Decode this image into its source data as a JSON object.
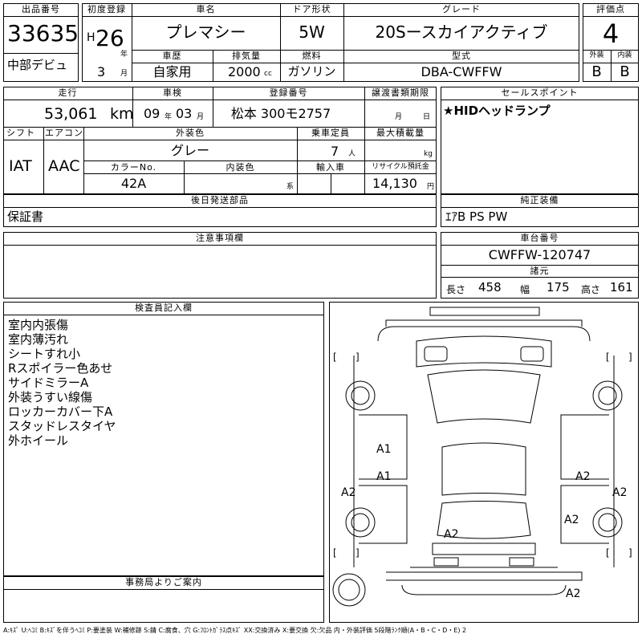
{
  "header": {
    "lot_number_label": "出品番号",
    "lot_number": "33635",
    "venue": "中部デビュ",
    "first_reg_label": "初度登録",
    "era": "H",
    "reg_year": "26",
    "year_unit": "年",
    "reg_month": "3",
    "month_unit": "月",
    "car_name_label": "車名",
    "car_name": "プレマシー",
    "door_label": "ドア形状",
    "doors": "5W",
    "grade_label": "グレード",
    "grade": "20Sースカイアクティブ",
    "score_label": "評価点",
    "score": "4",
    "history_label": "車歴",
    "history": "自家用",
    "displacement_label": "排気量",
    "displacement": "2000",
    "displacement_unit": "cc",
    "fuel_label": "燃料",
    "fuel": "ガソリン",
    "model_label": "型式",
    "model": "DBA-CWFFW",
    "exterior_label": "外装",
    "exterior_grade": "B",
    "interior_label": "内装",
    "interior_grade": "B"
  },
  "row2": {
    "mileage_label": "走行",
    "mileage": "53,061",
    "mileage_unit": "km",
    "inspection_label": "車検",
    "insp_year": "09",
    "insp_year_unit": "年",
    "insp_month": "03",
    "insp_month_unit": "月",
    "plate_label": "登録番号",
    "plate": "松本 300モ2757",
    "transfer_label": "譲渡書類期限",
    "transfer_month": "月",
    "transfer_day": "日",
    "sales_label": "セールスポイント",
    "sales_point": "★HIDヘッドランプ"
  },
  "row3": {
    "shift_label": "シフト",
    "shift": "IAT",
    "ac_label": "エアコン",
    "ac": "AAC",
    "ext_color_label": "外装色",
    "ext_color": "グレー",
    "capacity_label": "乗車定員",
    "capacity": "7",
    "capacity_unit": "人",
    "max_load_label": "最大積載量",
    "max_load_unit": "kg",
    "color_no_label": "カラーNo.",
    "color_no": "42A",
    "int_color_label": "内装色",
    "int_color_unit": "系",
    "import_label": "輸入車",
    "recycle_label": "リサイクル預託金",
    "recycle": "14,130",
    "recycle_unit": "円"
  },
  "parts": {
    "label": "後日発送部品",
    "value": "保証書"
  },
  "equipment": {
    "label": "純正装備",
    "value": "ｴｱB PS PW"
  },
  "caution": {
    "label": "注意事項欄"
  },
  "chassis": {
    "label": "車台番号",
    "number": "CWFFW-120747",
    "specs_label": "諸元",
    "length_label": "長さ",
    "length": "458",
    "width_label": "幅",
    "width": "175",
    "height_label": "高さ",
    "height": "161"
  },
  "inspector": {
    "label": "検査員記入欄",
    "notes": [
      "室内内張傷",
      "室内薄汚れ",
      "シートすれ小",
      "Rスポイラー色あせ",
      "サイドミラーA",
      "外装うすい線傷",
      "ロッカーカバー下A",
      "スタッドレスタイヤ",
      "外ホイール"
    ]
  },
  "office": {
    "label": "事務局よりご案内"
  },
  "diagram": {
    "marks": [
      "A1",
      "A1",
      "A2",
      "A2",
      "A2",
      "A2",
      "A2",
      "A2"
    ]
  },
  "legend": "A:ｷｽﾞ U:ﾍｺﾐ B:ｷｽﾞを伴うﾍｺﾐ P:要塗装 W:補修跡 S:錆 C:腐食、穴 G:ﾌﾛﾝﾄｶﾞﾗｽ点ｷｽﾞ XX:交換済み X:要交換 欠:欠品 内・外装評価 5段階ﾗﾝｸ順(A・B・C・D・E) 2"
}
